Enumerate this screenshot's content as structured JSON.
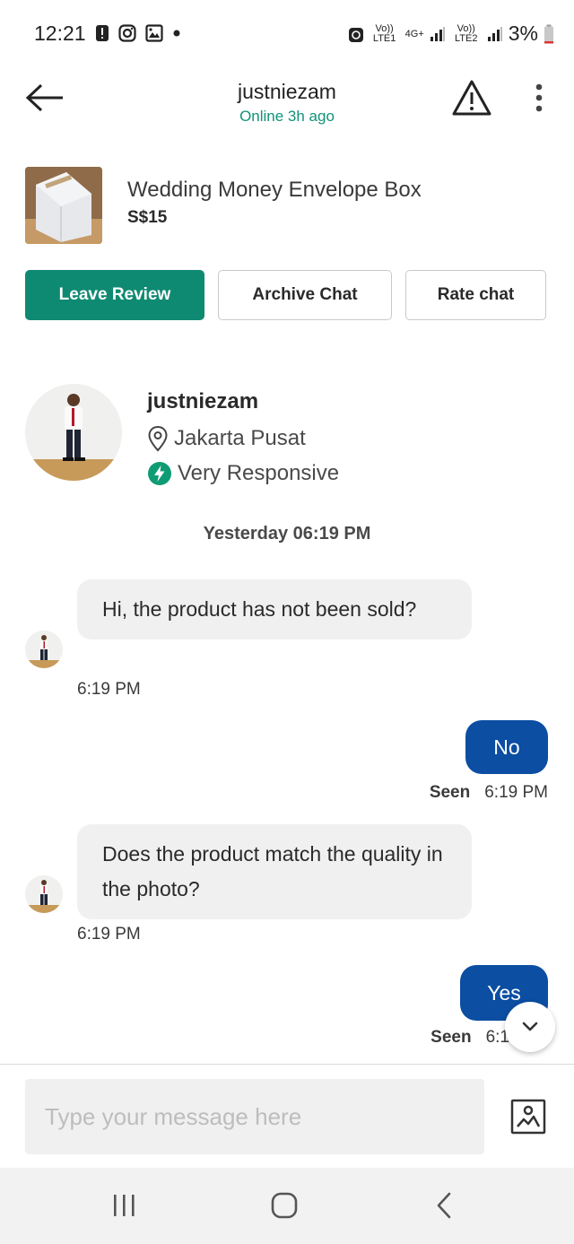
{
  "status_bar": {
    "time": "12:21",
    "battery": "3%",
    "sim1": "Vo)) LTE1",
    "net1": "4G+",
    "sim2": "Vo)) LTE2"
  },
  "header": {
    "title": "justniezam",
    "subtitle": "Online 3h ago"
  },
  "product": {
    "title": "Wedding Money Envelope Box",
    "price": "S$15"
  },
  "actions": {
    "leave_review": "Leave Review",
    "archive_chat": "Archive Chat",
    "rate_chat": "Rate chat"
  },
  "seller": {
    "name": "justniezam",
    "location": "Jakarta Pusat",
    "responsiveness": "Very Responsive"
  },
  "date_separator": "Yesterday 06:19 PM",
  "messages": [
    {
      "direction": "in",
      "text": "Hi, the product has not been sold?",
      "time": "6:19 PM"
    },
    {
      "direction": "out",
      "text": "No",
      "status": "Seen",
      "time": "6:19 PM"
    },
    {
      "direction": "in",
      "text": "Does the product match the quality in the photo?",
      "time": "6:19 PM"
    },
    {
      "direction": "out",
      "text": "Yes",
      "status": "Seen",
      "time": "6:1"
    }
  ],
  "composer": {
    "placeholder": "Type your message here"
  },
  "colors": {
    "accent_green": "#0f8a72",
    "online_green": "#119278",
    "outgoing_bubble": "#0b4ea2",
    "incoming_bubble": "#f0f0f0"
  },
  "icons": {
    "back": "arrow-left-icon",
    "report": "warning-triangle-icon",
    "more": "more-vertical-icon",
    "location": "location-pin-icon",
    "responsive": "lightning-icon",
    "scroll_down": "chevron-down-icon",
    "image": "image-icon"
  }
}
